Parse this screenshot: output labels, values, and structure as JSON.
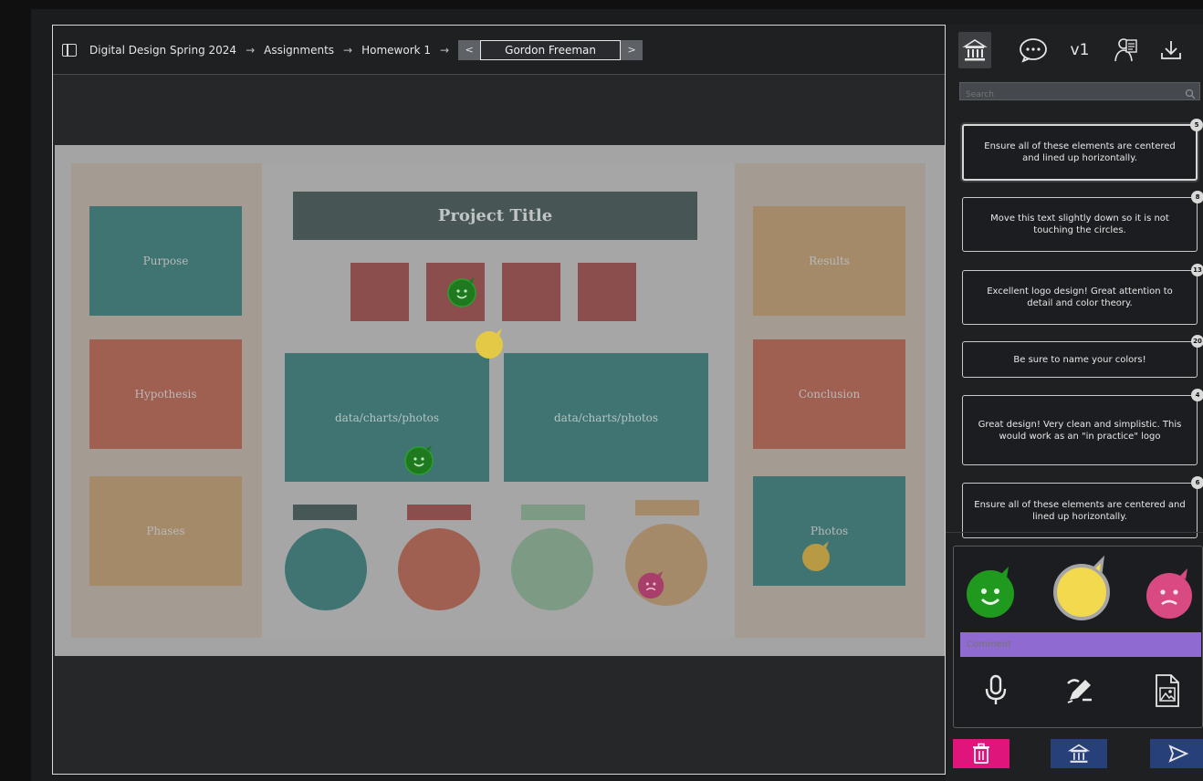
{
  "breadcrumb": {
    "items": [
      "Digital Design Spring 2024",
      "Assignments",
      "Homework 1"
    ],
    "separator": "→"
  },
  "student_nav": {
    "prev_label": "<",
    "next_label": ">",
    "current_student": "Gordon Freeman"
  },
  "poster": {
    "title": "Project Title",
    "left_panels": [
      "Purpose",
      "Hypothesis",
      "Phases"
    ],
    "right_panels": [
      "Results",
      "Conclusion",
      "Photos"
    ],
    "data_boxes": [
      "data/charts/photos",
      "data/charts/photos"
    ]
  },
  "toolbar": {
    "version_label": "v1",
    "icons": [
      "rubric-icon",
      "comment-bubble-icon",
      "student-icon",
      "download-icon"
    ]
  },
  "search": {
    "placeholder": "Search"
  },
  "comments": [
    {
      "text": "Ensure all of these elements are centered and lined up horizontally.",
      "count": "5",
      "active": true
    },
    {
      "text": "Move this text slightly down so it is not touching the circles.",
      "count": "8",
      "active": false
    },
    {
      "text": "Excellent logo design! Great attention to detail and color theory.",
      "count": "13",
      "active": false
    },
    {
      "text": "Be sure to name your colors!",
      "count": "20",
      "active": false
    },
    {
      "text": "Great design! Very clean and simplistic. This would work as an \"in practice\" logo",
      "count": "4",
      "active": false
    },
    {
      "text": "Ensure all of these elements are centered and lined up horizontally.",
      "count": "6",
      "active": false
    }
  ],
  "compose": {
    "placeholder": "Comment",
    "sentiments": [
      "happy-face-icon",
      "neutral-face-icon",
      "sad-face-icon"
    ],
    "tools": [
      "microphone-icon",
      "pen-icon",
      "image-file-icon"
    ]
  },
  "actions": [
    "trash-icon",
    "rubric-icon",
    "send-icon"
  ],
  "colors": {
    "happy": "#1f9a1f",
    "neutral": "#f2d94e",
    "sad": "#d94a82",
    "comment_input": "#8f6ad0",
    "delete": "#e0157c",
    "action_blue": "#27407a"
  }
}
